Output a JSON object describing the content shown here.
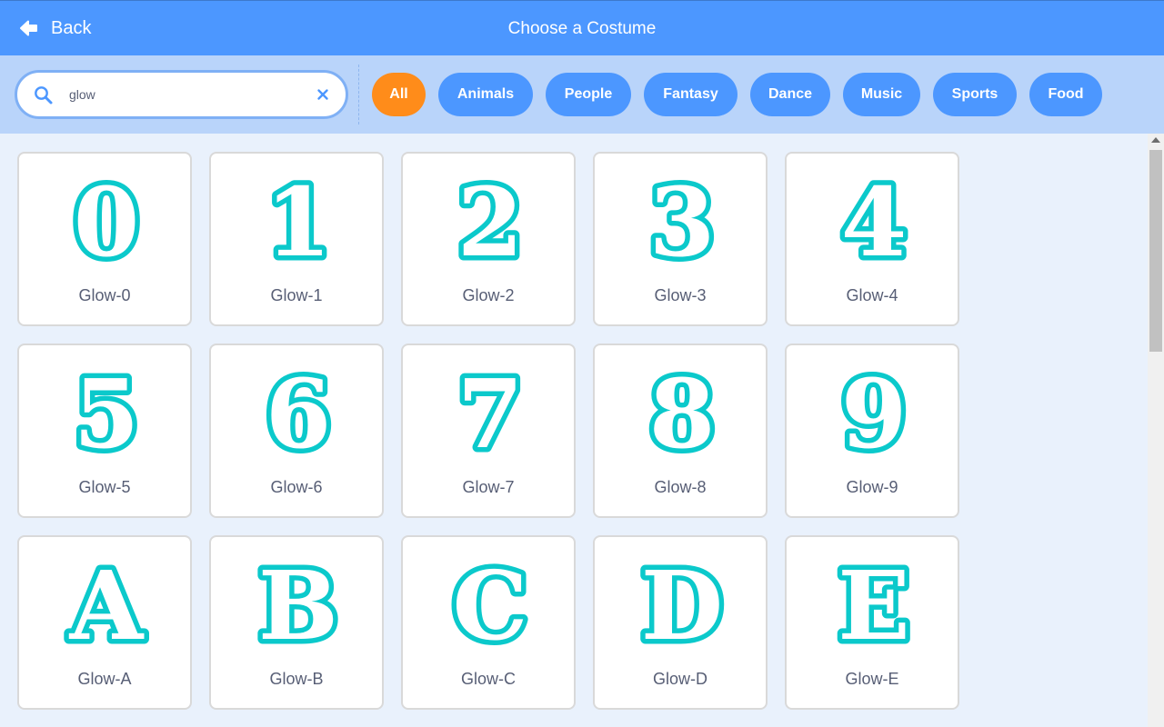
{
  "header": {
    "back_label": "Back",
    "title": "Choose a Costume"
  },
  "search": {
    "value": "glow"
  },
  "tags": [
    "All",
    "Animals",
    "People",
    "Fantasy",
    "Dance",
    "Music",
    "Sports",
    "Food"
  ],
  "active_tag": "All",
  "costume_color": "#0bc9cb",
  "costumes": [
    {
      "glyph": "0",
      "name": "Glow-0"
    },
    {
      "glyph": "1",
      "name": "Glow-1"
    },
    {
      "glyph": "2",
      "name": "Glow-2"
    },
    {
      "glyph": "3",
      "name": "Glow-3"
    },
    {
      "glyph": "4",
      "name": "Glow-4"
    },
    {
      "glyph": "5",
      "name": "Glow-5"
    },
    {
      "glyph": "6",
      "name": "Glow-6"
    },
    {
      "glyph": "7",
      "name": "Glow-7"
    },
    {
      "glyph": "8",
      "name": "Glow-8"
    },
    {
      "glyph": "9",
      "name": "Glow-9"
    },
    {
      "glyph": "A",
      "name": "Glow-A"
    },
    {
      "glyph": "B",
      "name": "Glow-B"
    },
    {
      "glyph": "C",
      "name": "Glow-C"
    },
    {
      "glyph": "D",
      "name": "Glow-D"
    },
    {
      "glyph": "E",
      "name": "Glow-E"
    }
  ]
}
